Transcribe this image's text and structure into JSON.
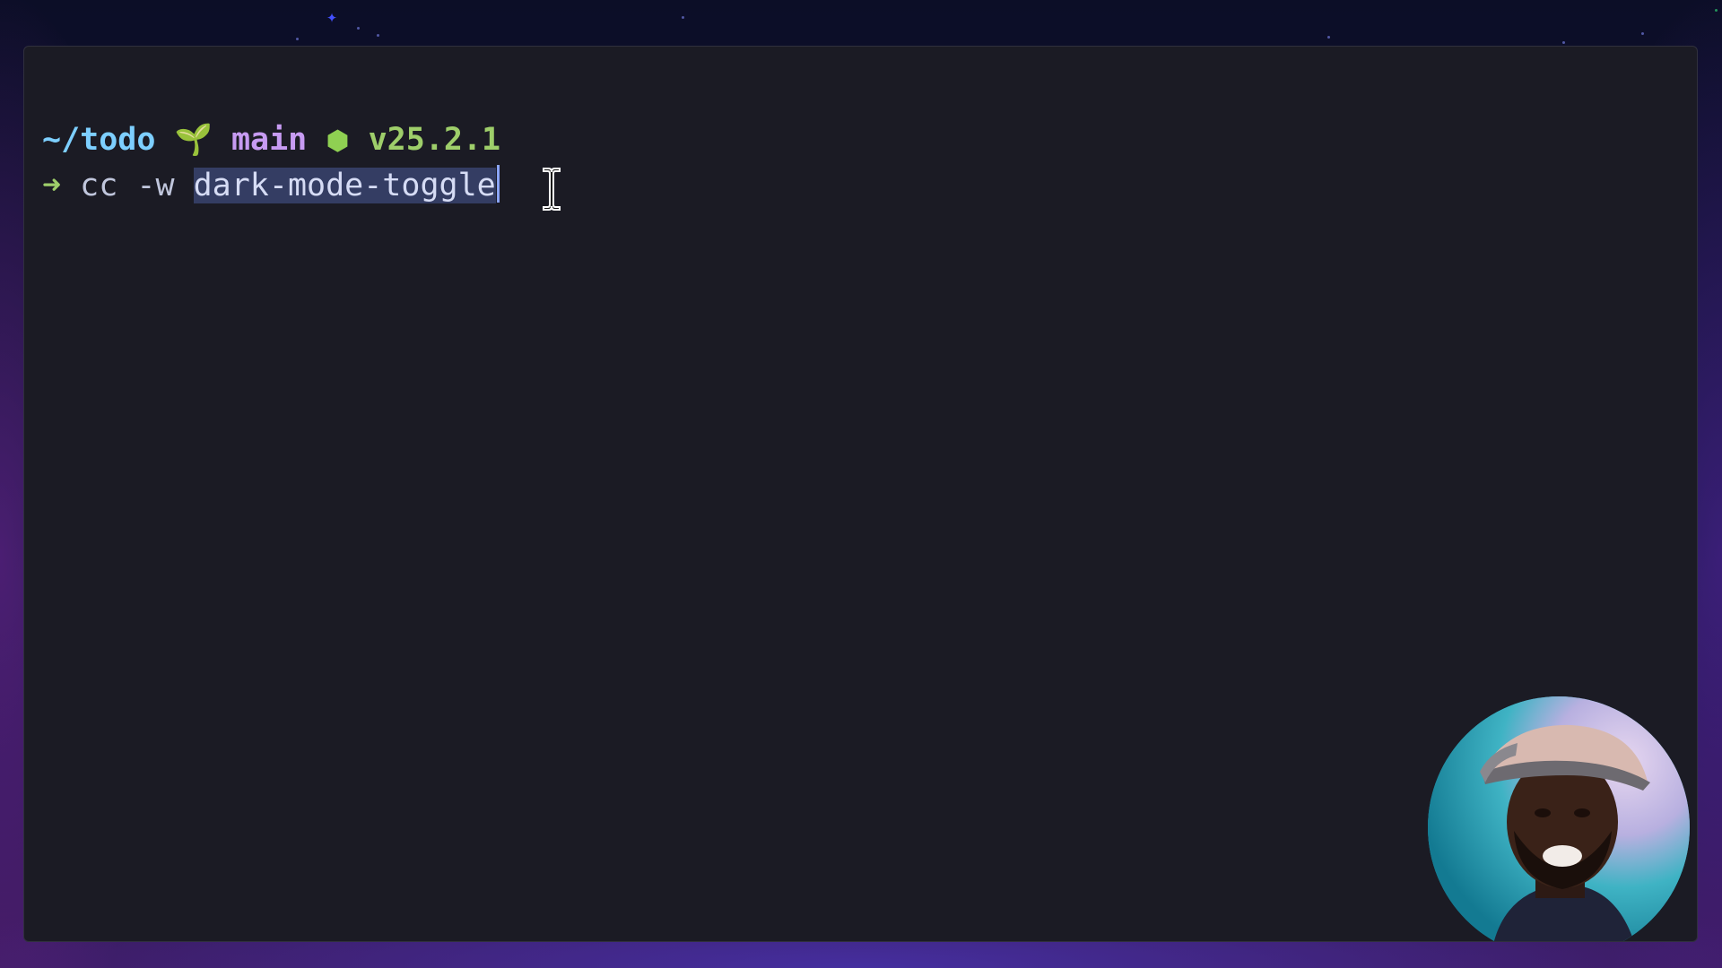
{
  "terminal": {
    "prompt": {
      "path": "~/todo",
      "branch_icon": "sprout-icon",
      "branch": "main",
      "node_icon": "nodejs-hexagon-icon",
      "node_version": "v25.2.1"
    },
    "command": {
      "prompt_symbol": "➜",
      "text": "cc -w ",
      "selected_text": "dark-mode-toggle"
    }
  },
  "colors": {
    "path": "#7dcfff",
    "branch": "#c79bf2",
    "version": "#9ece6a",
    "terminal_background": "#1b1b24",
    "selection": "#343d63"
  }
}
